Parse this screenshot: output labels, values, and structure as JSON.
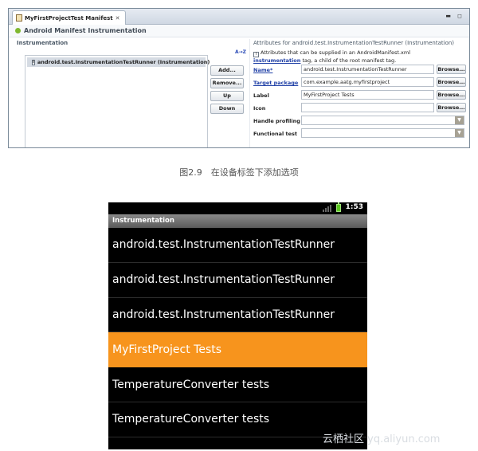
{
  "eclipse": {
    "tab_title": "MyFirstProjectTest Manifest",
    "tab_close": "✕",
    "window_controls": "▬ ◻",
    "header": "Android Manifest Instrumentation",
    "instrumentation_label": "Instrumentation",
    "sort_label": "A→Z",
    "tree_items": [
      {
        "icon_text": "I",
        "label": "android.test.InstrumentationTestRunner (Instrumentation)"
      }
    ],
    "buttons": [
      "Add...",
      "Remove...",
      "Up",
      "Down"
    ],
    "attributes_title": "Attributes for android.test.InstrumentationTestRunner (Instrumentation)",
    "info_icon": "I",
    "info_text_1": "Attributes that can be supplied in an AndroidManifest.xml",
    "info_link": "instrumentation",
    "info_text_2": "tag, a child of the root manifest tag.",
    "attributes": [
      {
        "label": "Name*",
        "value": "android.test.InstrumentationTestRunner",
        "browse": "Browse..."
      },
      {
        "label": "Target package",
        "value": "com.example.aatg.myfirstproject",
        "browse": "Browse..."
      },
      {
        "label": "Label",
        "value": "MyFirstProject Tests",
        "browse": "Browse..."
      },
      {
        "label": "Icon",
        "value": "",
        "browse": "Browse..."
      },
      {
        "label": "Handle profiling",
        "value": ""
      },
      {
        "label": "Functional test",
        "value": ""
      }
    ]
  },
  "caption": "图2.9　在设备标签下添加选项",
  "android": {
    "clock": "1:53",
    "title": "Instrumentation",
    "items": [
      "android.test.InstrumentationTestRunner",
      "android.test.InstrumentationTestRunner",
      "android.test.InstrumentationTestRunner",
      "MyFirstProject Tests",
      "TemperatureConverter tests",
      "TemperatureConverter tests"
    ],
    "selected_index": 3
  },
  "watermark": "云栖社区 yq.aliyun.com",
  "colors": {
    "selection_orange": "#f7941d",
    "link_blue": "#1f3fa6",
    "tree_selection": "#d5dbe3"
  }
}
